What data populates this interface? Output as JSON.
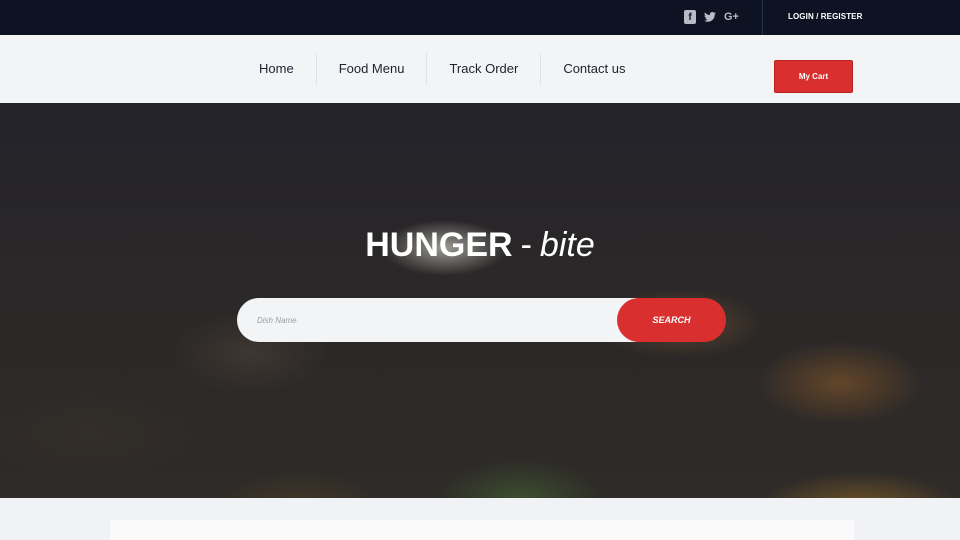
{
  "topbar": {
    "social": [
      {
        "icon": "facebook-icon",
        "glyph": "f"
      },
      {
        "icon": "twitter-icon",
        "glyph": "🐦"
      },
      {
        "icon": "google-plus-icon",
        "glyph": "G+"
      }
    ],
    "login_label": "LOGIN / REGISTER"
  },
  "nav": {
    "items": [
      "Home",
      "Food Menu",
      "Track Order",
      "Contact us"
    ],
    "cart_label": "My Cart"
  },
  "hero": {
    "title_main": "HUNGER",
    "title_dash": "-",
    "title_accent": "bite",
    "search_placeholder": "Dish Name",
    "search_button": "SEARCH"
  },
  "colors": {
    "accent": "#d9302f",
    "topbar_bg": "#0d1322",
    "nav_bg": "#f3f4f6"
  }
}
